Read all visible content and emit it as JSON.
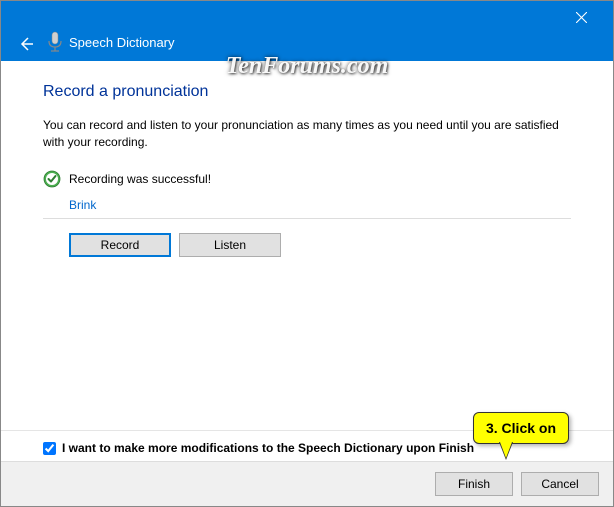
{
  "titlebar": {
    "title": "Speech Dictionary"
  },
  "watermark": "TenForums.com",
  "main": {
    "heading": "Record a pronunciation",
    "description": "You can record and listen to your pronunciation as many times as you need until you are satisfied with your recording.",
    "status": "Recording was successful!",
    "word": "Brink",
    "record_label": "Record",
    "listen_label": "Listen"
  },
  "checkbox": {
    "label": "I want to make more modifications to the Speech Dictionary upon Finish",
    "checked": true
  },
  "footer": {
    "finish_label": "Finish",
    "cancel_label": "Cancel"
  },
  "callout": {
    "text": "3. Click on"
  }
}
